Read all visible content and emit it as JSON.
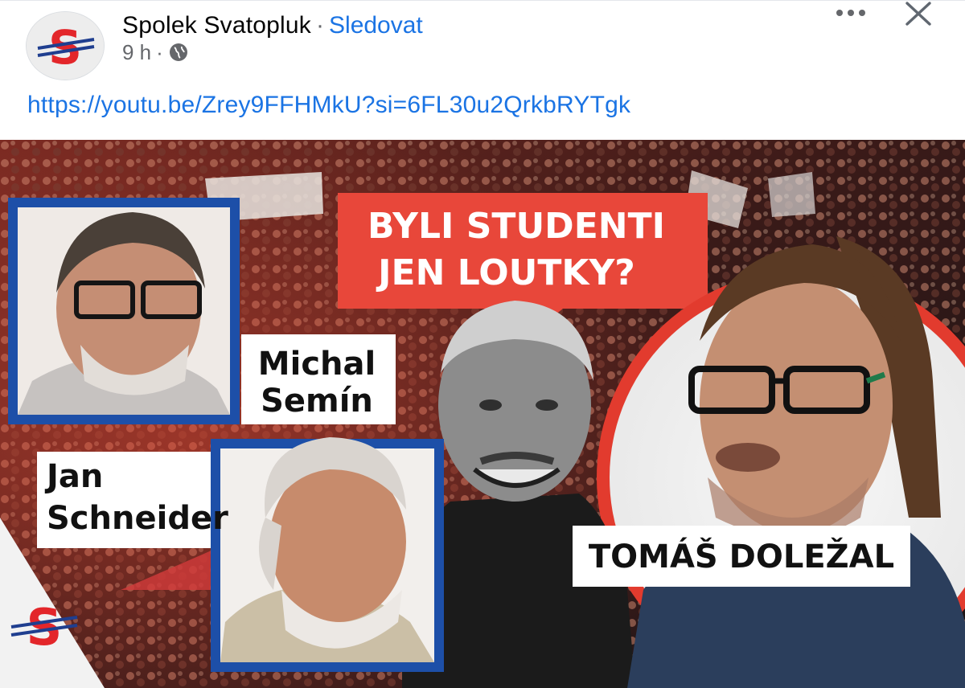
{
  "post": {
    "author": "Spolek Svatopluk",
    "separator": "·",
    "follow_label": "Sledovat",
    "time": "9 h",
    "meta_separator": "·",
    "privacy_icon": "globe-icon",
    "link": "https://youtu.be/Zrey9FFHMkU?si=6FL30u2QrkbRYTgk"
  },
  "thumbnail": {
    "headline_line1": "BYLI STUDENTI",
    "headline_line2": "JEN LOUTKY?",
    "guest1_line1": "Michal",
    "guest1_line2": "Semín",
    "guest2_line1": "Jan",
    "guest2_line2": "Schneider",
    "host_name": "TOMÁŠ DOLEŽAL"
  },
  "colors": {
    "link_blue": "#1b74e4",
    "logo_red": "#e3262a",
    "logo_blue": "#1f3e8f",
    "frame_blue": "#1d4fa8",
    "bubble_red": "#e8473a"
  },
  "icons": [
    "more-options-icon",
    "close-icon",
    "globe-icon",
    "page-logo-icon"
  ]
}
